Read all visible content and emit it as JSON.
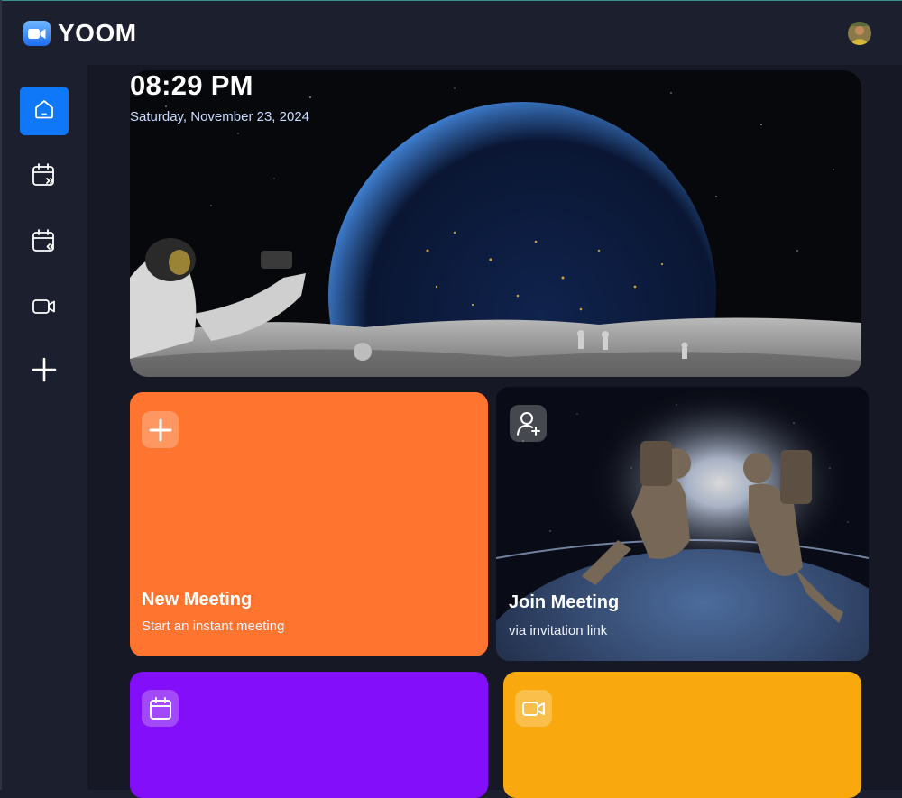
{
  "app": {
    "brand": "YOOM"
  },
  "header": {
    "avatar_label": "user-avatar"
  },
  "sidebar": {
    "items": [
      {
        "icon": "home-icon",
        "active": true
      },
      {
        "icon": "upcoming-calendar-icon",
        "active": false
      },
      {
        "icon": "previous-calendar-icon",
        "active": false
      },
      {
        "icon": "video-icon",
        "active": false
      },
      {
        "icon": "plus-icon",
        "active": false
      }
    ]
  },
  "hero": {
    "time": "08:29 PM",
    "date": "Saturday, November 23, 2024"
  },
  "cards": [
    {
      "title": "New Meeting",
      "subtitle": "Start an instant meeting",
      "icon": "plus-icon",
      "color": "#ff742e"
    },
    {
      "title": "Join Meeting",
      "subtitle": "via invitation link",
      "icon": "add-user-icon",
      "color": "#1b1f2e"
    },
    {
      "title": "",
      "subtitle": "",
      "icon": "calendar-icon",
      "color": "#830ef9"
    },
    {
      "title": "",
      "subtitle": "",
      "icon": "video-icon",
      "color": "#f9a90e"
    }
  ],
  "colors": {
    "background": "#1c1f2e",
    "main_background": "#161925",
    "accent_blue": "#0e78f9",
    "orange": "#ff742e",
    "purple": "#830ef9",
    "yellow": "#f9a90e"
  }
}
